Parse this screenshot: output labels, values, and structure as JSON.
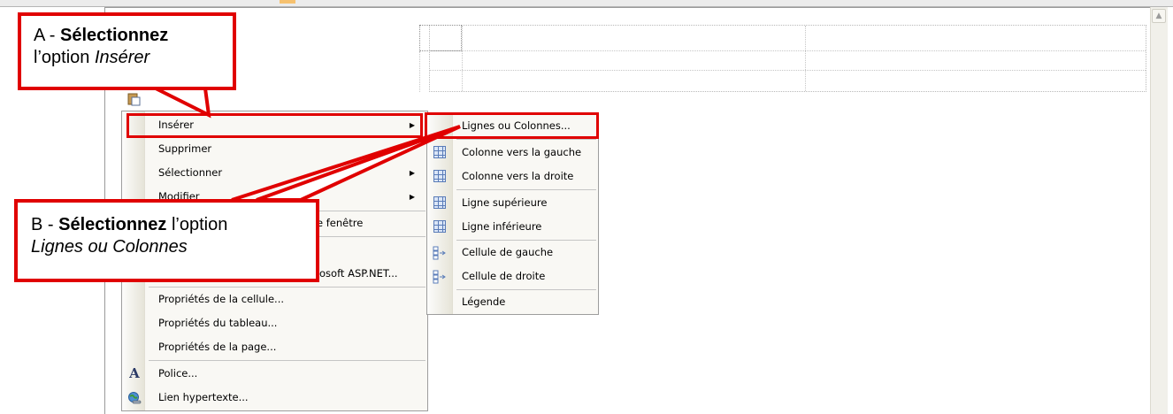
{
  "context_menu": {
    "items": [
      {
        "label": "Insérer",
        "has_submenu": true
      },
      {
        "label": "Supprimer",
        "has_submenu": false
      },
      {
        "label": "Sélectionner",
        "has_submenu": true
      },
      {
        "label": "Modifier",
        "has_submenu": true
      },
      {
        "label": "e fenêtre",
        "has_submenu": false
      },
      {
        "label": "osoft ASP.NET...",
        "has_submenu": false
      },
      {
        "label": "Propriétés de la cellule...",
        "has_submenu": false
      },
      {
        "label": "Propriétés du tableau...",
        "has_submenu": false
      },
      {
        "label": "Propriétés de la page...",
        "has_submenu": false
      },
      {
        "label": "Police...",
        "has_submenu": false,
        "icon": "font-a-icon"
      },
      {
        "label": "Lien hypertexte...",
        "has_submenu": false,
        "icon": "hyperlink-globe-icon"
      }
    ]
  },
  "submenu": {
    "items": [
      {
        "label": "Lignes ou Colonnes...",
        "icon": null
      },
      {
        "label": "Colonne vers la gauche",
        "icon": "insert-column-left-icon"
      },
      {
        "label": "Colonne vers la droite",
        "icon": "insert-column-right-icon"
      },
      {
        "label": "Ligne supérieure",
        "icon": "insert-row-above-icon"
      },
      {
        "label": "Ligne inférieure",
        "icon": "insert-row-below-icon"
      },
      {
        "label": "Cellule de gauche",
        "icon": "insert-cell-left-icon"
      },
      {
        "label": "Cellule de droite",
        "icon": "insert-cell-right-icon"
      },
      {
        "label": "Légende",
        "icon": null
      }
    ]
  },
  "callouts": {
    "a": {
      "prefix": "A - ",
      "bold": "Sélectionnez",
      "middle": "l’option ",
      "italic": "Insérer"
    },
    "b": {
      "prefix": "B - ",
      "bold": "Sélectionnez",
      "middle": " l’option",
      "italic": "Lignes ou Colonnes"
    }
  },
  "colors": {
    "highlight": "#e00000",
    "menu_bg": "#f9f8f4",
    "icon_blue": "#5a7cb8"
  }
}
